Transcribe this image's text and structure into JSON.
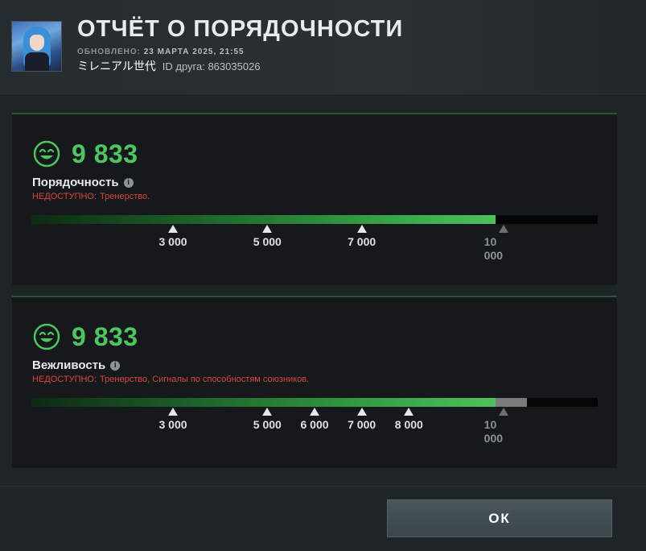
{
  "header": {
    "title": "ОТЧЁТ О ПОРЯДОЧНОСТИ",
    "updated_label": "ОБНОВЛЕНО:",
    "updated_value": "23 МАРТА 2025, 21:55",
    "username": "ミレニアル世代",
    "friend_id_label": "ID друга: 863035026"
  },
  "scale_max": 10000,
  "panels": [
    {
      "score": "9 833",
      "score_value": 9833,
      "label": "Порядочность",
      "unavailable_label": "НЕДОСТУПНО:",
      "unavailable_value": "Тренерство.",
      "track_value": null,
      "ticks": [
        "3 000",
        "5 000",
        "7 000"
      ],
      "tick_values": [
        3000,
        5000,
        7000
      ],
      "max_label": "10 000"
    },
    {
      "score": "9 833",
      "score_value": 9833,
      "label": "Вежливость",
      "unavailable_label": "НЕДОСТУПНО:",
      "unavailable_value": "Тренерство, Сигналы по способностям союзников.",
      "track_value": 10500,
      "ticks": [
        "3 000",
        "5 000",
        "6 000",
        "7 000",
        "8 000"
      ],
      "tick_values": [
        3000,
        5000,
        6000,
        7000,
        8000
      ],
      "max_label": "10 000"
    }
  ],
  "footer": {
    "ok_label": "ОК"
  },
  "colors": {
    "score_green": "#4fc560",
    "unavailable_red": "#d9463a",
    "panel_bg": "#15191c"
  },
  "icons": {
    "score": "smiley-icon",
    "info": "info-icon"
  }
}
